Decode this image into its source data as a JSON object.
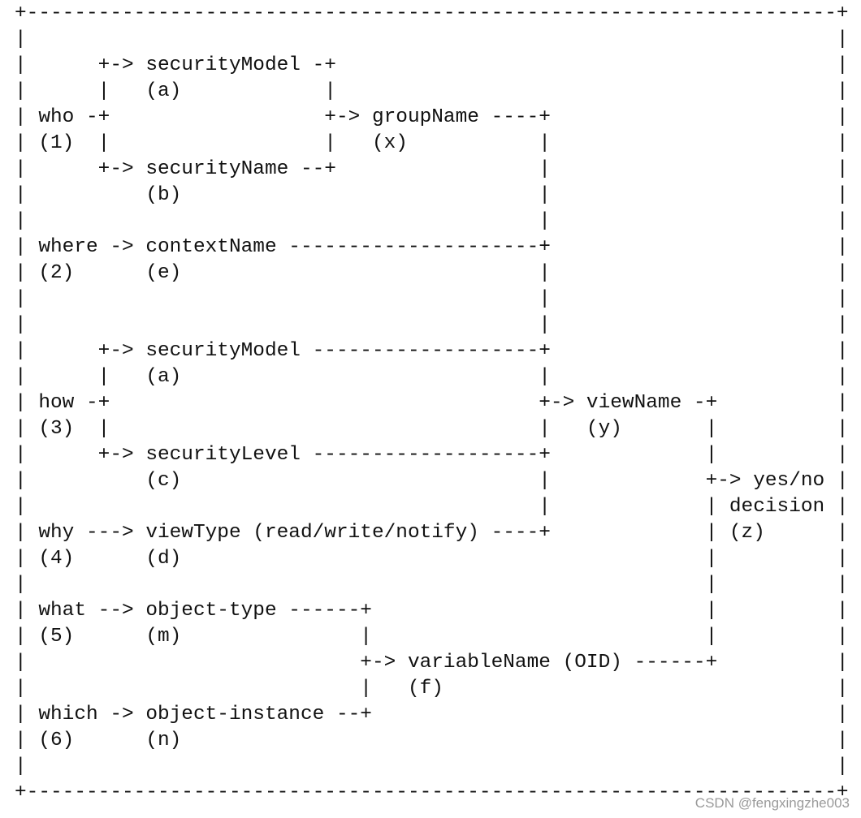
{
  "diagram": {
    "lines": [
      "+--------------------------------------------------------------------+",
      "|                                                                    |",
      "|      +-> securityModel -+                                          |",
      "|      |   (a)            |                                          |",
      "| who -+                  +-> groupName ----+                        |",
      "| (1)  |                  |   (x)           |                        |",
      "|      +-> securityName --+                 |                        |",
      "|          (b)                              |                        |",
      "|                                           |                        |",
      "| where -> contextName ---------------------+                        |",
      "| (2)      (e)                              |                        |",
      "|                                           |                        |",
      "|                                           |                        |",
      "|      +-> securityModel -------------------+                        |",
      "|      |   (a)                              |                        |",
      "| how -+                                    +-> viewName -+          |",
      "| (3)  |                                    |   (y)       |          |",
      "|      +-> securityLevel -------------------+             |          |",
      "|          (c)                              |             +-> yes/no |",
      "|                                           |             | decision |",
      "| why ---> viewType (read/write/notify) ----+             | (z)      |",
      "| (4)      (d)                                            |          |",
      "|                                                         |          |",
      "| what --> object-type ------+                            |          |",
      "| (5)      (m)               |                            |          |",
      "|                            +-> variableName (OID) ------+          |",
      "|                            |   (f)                                 |",
      "| which -> object-instance --+                                       |",
      "| (6)      (n)                                                       |",
      "|                                                                    |",
      "+--------------------------------------------------------------------+"
    ]
  },
  "watermark": "CSDN @fengxingzhe003"
}
